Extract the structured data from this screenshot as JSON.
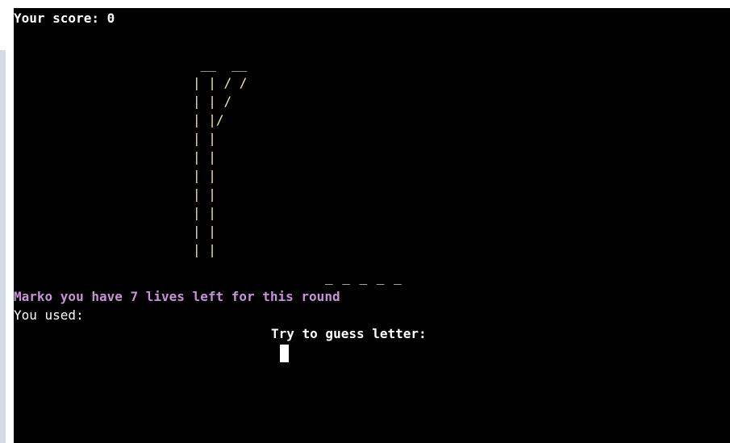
{
  "score_text": "Your score: 0",
  "gallows_art": " __  __\n| | / /\n| | /\n| |/\n| |\n| |\n| |\n| |\n| |\n| |\n| |",
  "word_display": "_ _ _ _ _",
  "lives_message": "Marko you have 7 lives left for this round",
  "used_letters_label": "You used:",
  "guess_prompt": "Try to guess letter:",
  "colors": {
    "background": "#000000",
    "text": "#ffffff",
    "gallows": "#f5e8a3",
    "lives": "#c792d8"
  }
}
